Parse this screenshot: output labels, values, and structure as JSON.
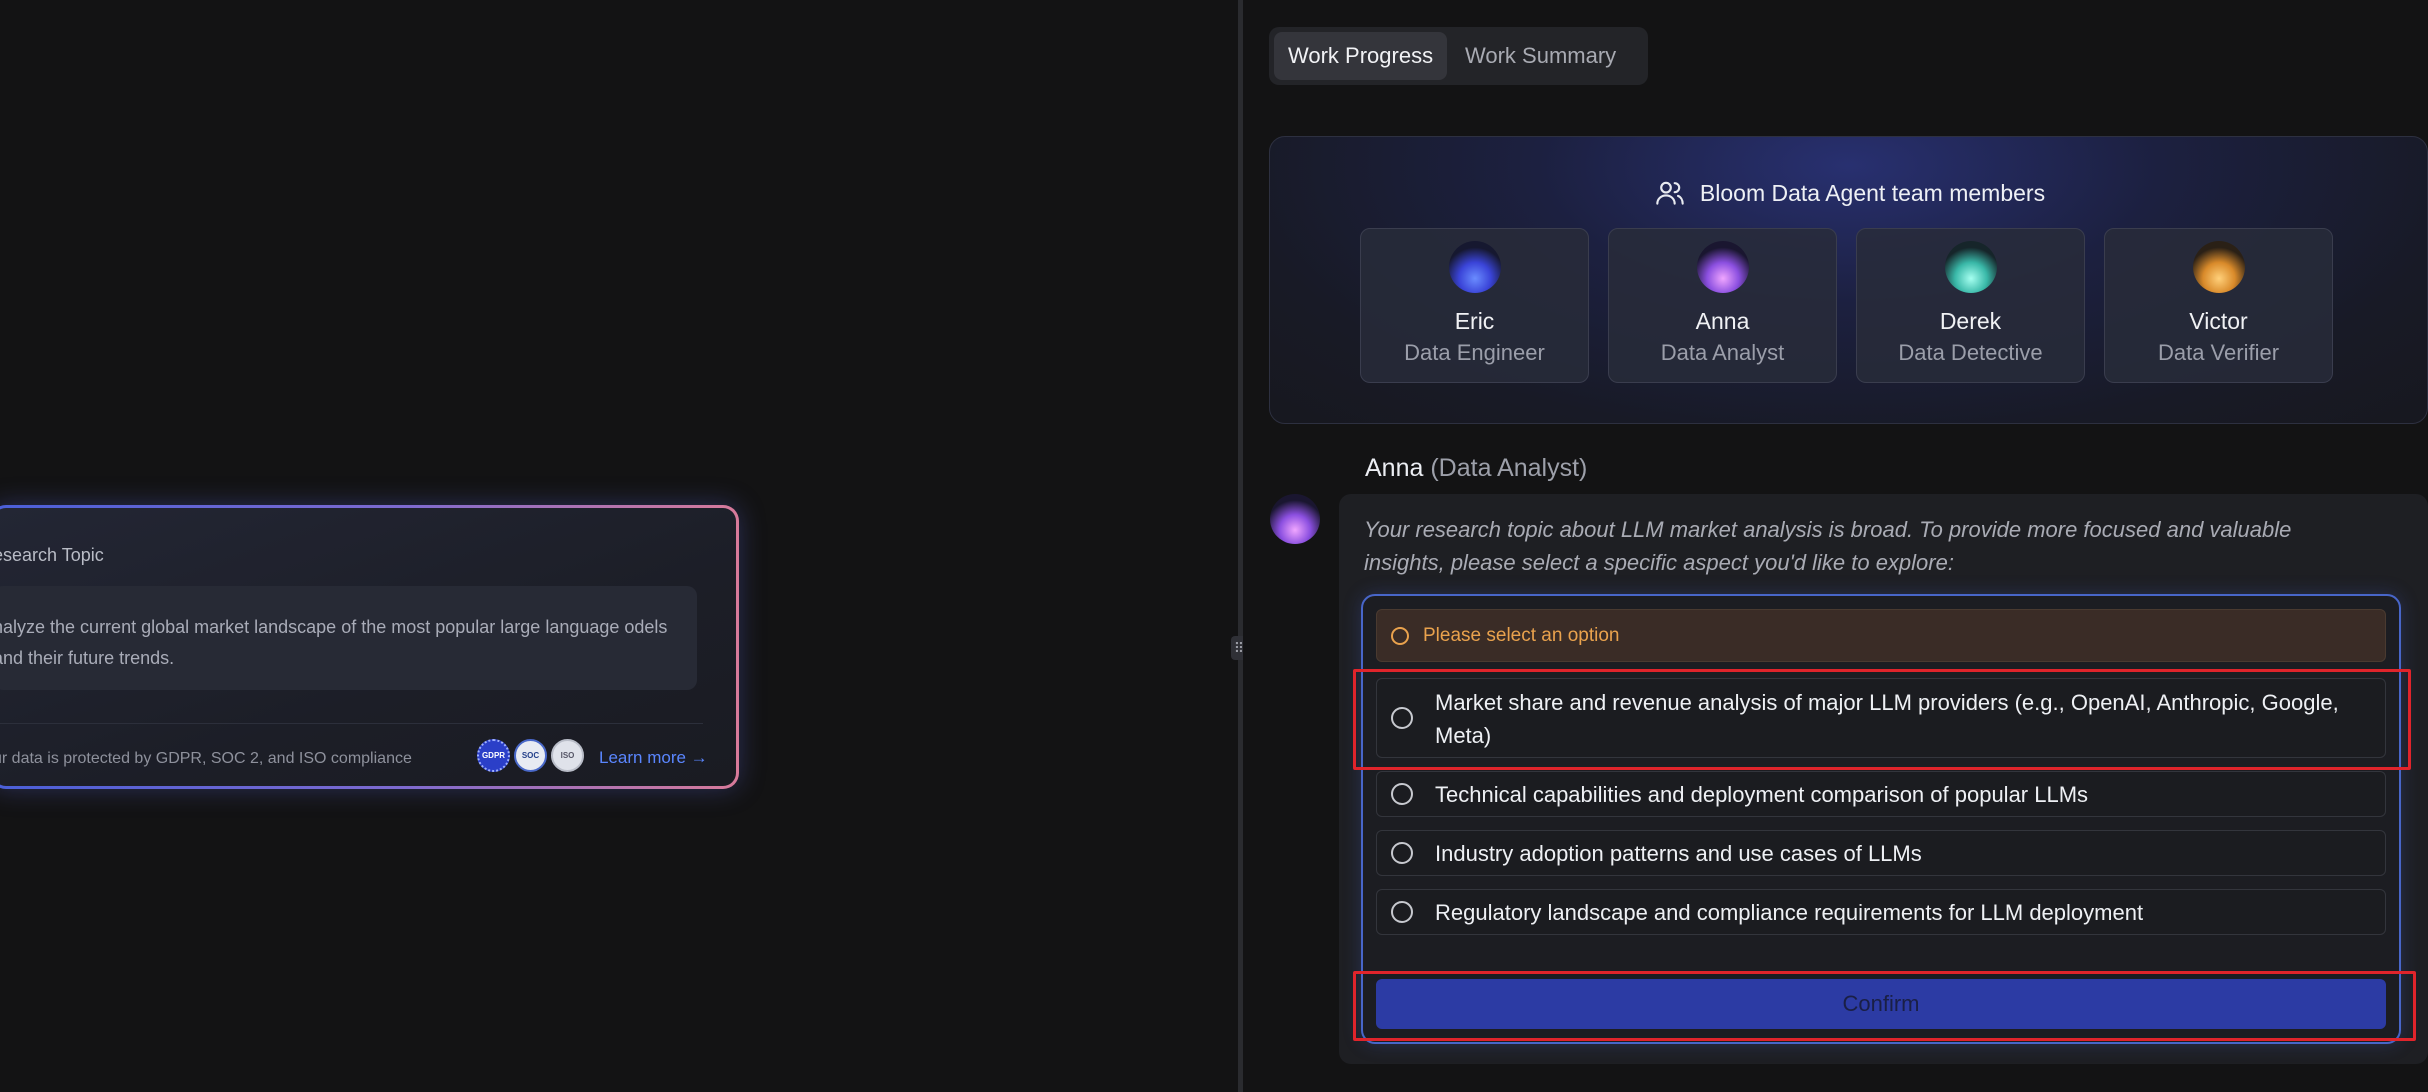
{
  "left": {
    "research_title": "esearch Topic",
    "research_text": "nalyze the current global market landscape of the most popular large language odels and their future trends.",
    "compliance_text": "ur data is protected by GDPR, SOC 2, and ISO compliance",
    "badges": [
      "GDPR",
      "SOC",
      "ISO"
    ],
    "learn_more": "Learn more →"
  },
  "tabs": [
    {
      "label": "Work Progress",
      "active": true
    },
    {
      "label": "Work Summary",
      "active": false
    }
  ],
  "team": {
    "title": "Bloom Data Agent team members",
    "members": [
      {
        "name": "Eric",
        "role": "Data Engineer"
      },
      {
        "name": "Anna",
        "role": "Data Analyst"
      },
      {
        "name": "Derek",
        "role": "Data Detective"
      },
      {
        "name": "Victor",
        "role": "Data Verifier"
      }
    ]
  },
  "chat": {
    "speaker_name": "Anna",
    "speaker_role": "(Data Analyst)",
    "message": "Your research topic about LLM market analysis is broad. To provide more focused and valuable insights, please select a specific aspect you'd like to explore:",
    "warning": "Please select an option",
    "options": [
      "Market share and revenue analysis of major LLM providers (e.g., OpenAI, Anthropic, Google, Meta)",
      "Technical capabilities and deployment comparison of popular LLMs",
      "Industry adoption patterns and use cases of LLMs",
      "Regulatory landscape and compliance requirements for LLM deployment"
    ],
    "confirm_label": "Confirm"
  },
  "colors": {
    "accent_blue": "#4866c9",
    "warning": "#e9a24d",
    "highlight_red": "#e0242b",
    "confirm_bg": "#2c3ba4"
  }
}
